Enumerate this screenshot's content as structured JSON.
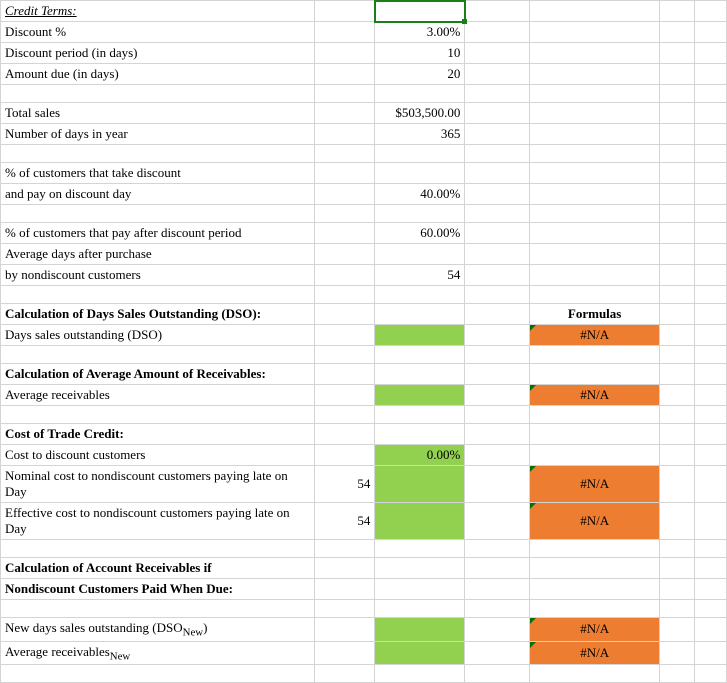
{
  "creditTerms": {
    "header": "Credit Terms:",
    "discountPctLabel": "Discount %",
    "discountPctValue": "3.00%",
    "discountPeriodLabel": "Discount period (in days)",
    "discountPeriodValue": "10",
    "amountDueLabel": "Amount due (in days)",
    "amountDueValue": "20",
    "totalSalesLabel": "Total sales",
    "totalSalesValue": "$503,500.00",
    "daysInYearLabel": "Number of days in year",
    "daysInYearValue": "365",
    "pctDiscountLine1": "% of customers that take discount",
    "pctDiscountLine2": "and pay on discount day",
    "pctDiscountValue": "40.00%",
    "pctAfterLabel": "% of customers that pay after discount period",
    "pctAfterValue": "60.00%",
    "avgDaysLine1": "Average days after purchase",
    "avgDaysLine2": "by nondiscount customers",
    "avgDaysValue": "54"
  },
  "dsoSection": {
    "header": "Calculation of Days Sales Outstanding (DSO):",
    "formulasHeader": "Formulas",
    "dsoLabel": "Days sales outstanding (DSO)",
    "dsoFormula": "#N/A"
  },
  "avgReceivables": {
    "header": "Calculation of Average Amount of Receivables:",
    "label": "Average receivables",
    "formula": "#N/A"
  },
  "tradeCredit": {
    "header": "Cost of Trade Credit:",
    "discountCustomersLabel": "Cost to discount customers",
    "discountCustomersValue": "0.00%",
    "nominalLabel": "Nominal cost to nondiscount customers paying late on Day",
    "nominalDay": "54",
    "nominalFormula": "#N/A",
    "effectiveLabel": "Effective cost to nondiscount customers paying late on Day",
    "effectiveDay": "54",
    "effectiveFormula": "#N/A"
  },
  "arWhenDue": {
    "headerLine1": "Calculation of Account Receivables if",
    "headerLine2": "Nondiscount Customers Paid When Due:",
    "newDsoLabelPrefix": "New days sales outstanding (DSO",
    "newDsoLabelSub": "New",
    "newDsoLabelSuffix": ")",
    "newDsoFormula": "#N/A",
    "avgRecLabelPrefix": "Average receivables",
    "avgRecLabelSub": "New",
    "avgRecFormula": "#N/A"
  }
}
